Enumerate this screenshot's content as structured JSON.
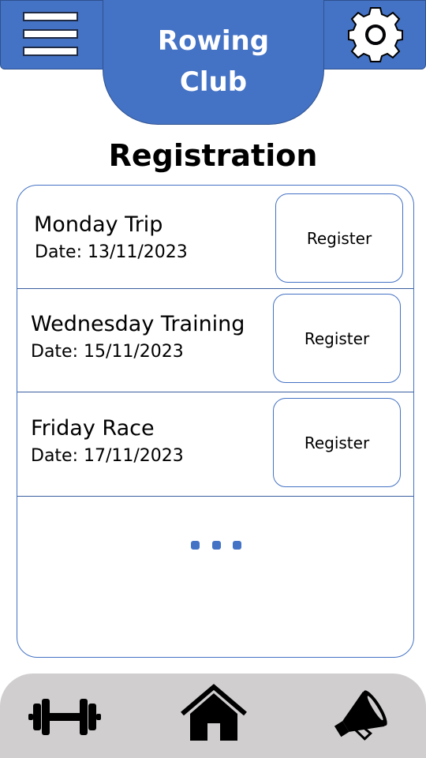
{
  "header": {
    "title": "Rowing Club",
    "menu_icon": "hamburger-menu-icon",
    "settings_icon": "gear-icon",
    "accent_color": "#4472C4"
  },
  "page": {
    "title": "Registration"
  },
  "events": [
    {
      "name": "Monday Trip",
      "date": "Date: 13/11/2023",
      "button_label": "Register"
    },
    {
      "name": "Wednesday Training",
      "date": "Date: 15/11/2023",
      "button_label": "Register"
    },
    {
      "name": "Friday Race",
      "date": "Date: 17/11/2023",
      "button_label": "Register"
    }
  ],
  "list": {
    "more_indicator_icon": "ellipsis-icon"
  },
  "bottom_nav": {
    "items": [
      {
        "icon": "dumbbell-icon"
      },
      {
        "icon": "home-icon"
      },
      {
        "icon": "megaphone-icon"
      }
    ],
    "background_color": "#D0CECE"
  }
}
